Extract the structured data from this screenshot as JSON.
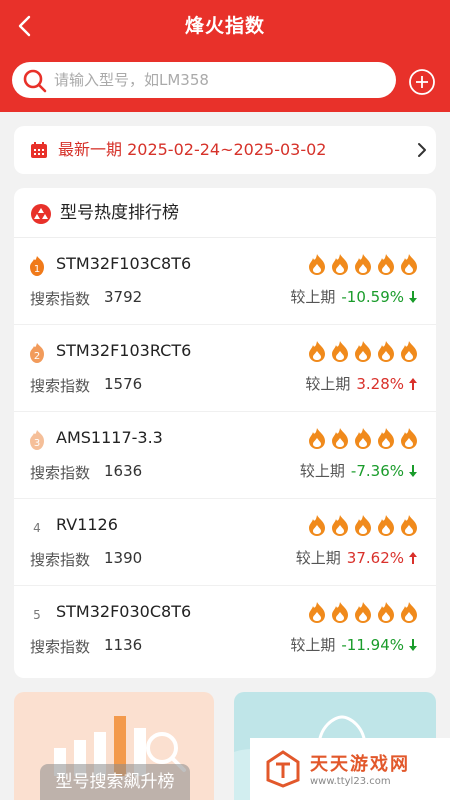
{
  "header": {
    "title": "烽火指数",
    "search_placeholder": "请输入型号，如LM358"
  },
  "period": {
    "text": "最新一期 2025-02-24~2025-03-02"
  },
  "ranking": {
    "title": "型号热度排行榜",
    "index_label": "搜索指数",
    "compare_label": "较上期",
    "items": [
      {
        "rank": "1",
        "model": "STM32F103C8T6",
        "index": "3792",
        "change": "-10.59%",
        "trend": "down"
      },
      {
        "rank": "2",
        "model": "STM32F103RCT6",
        "index": "1576",
        "change": "3.28%",
        "trend": "up"
      },
      {
        "rank": "3",
        "model": "AMS1117-3.3",
        "index": "1636",
        "change": "-7.36%",
        "trend": "down"
      },
      {
        "rank": "4",
        "model": "RV1126",
        "index": "1390",
        "change": "37.62%",
        "trend": "up"
      },
      {
        "rank": "5",
        "model": "STM32F030C8T6",
        "index": "1136",
        "change": "-11.94%",
        "trend": "down"
      }
    ]
  },
  "promo": {
    "left_label": "型号搜索飙升榜"
  },
  "watermark": {
    "title": "天天游戏网",
    "url": "www.ttyl23.com"
  },
  "colors": {
    "brand_red": "#e8312a",
    "up": "#d9312b",
    "down": "#1a9c2b",
    "flame": "#f08a1c"
  }
}
